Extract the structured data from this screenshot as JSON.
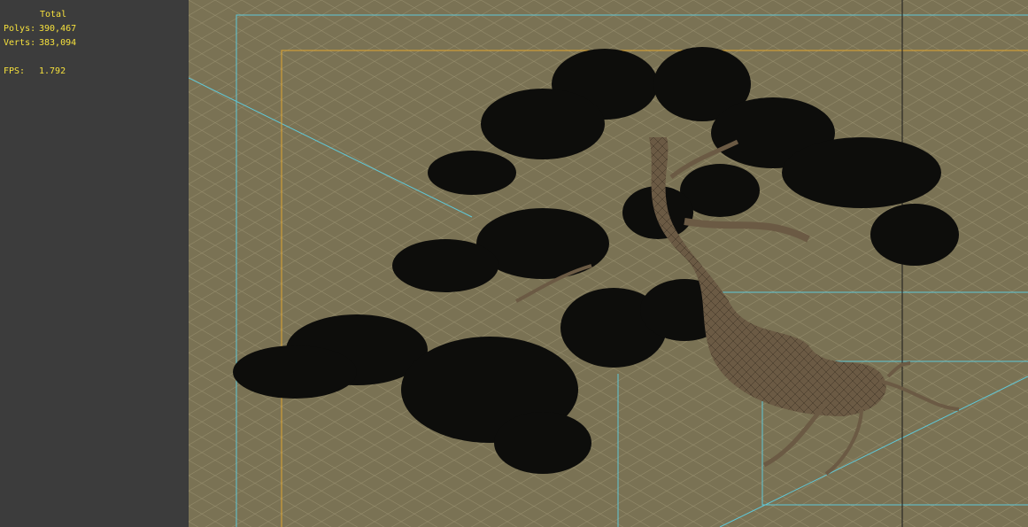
{
  "stats": {
    "header": "Total",
    "polys_label": "Polys:",
    "polys_value": "390,467",
    "verts_label": "Verts:",
    "verts_value": "383,094",
    "fps_label": "FPS:",
    "fps_value": "1.792"
  },
  "colors": {
    "panel": "#3c3c3c",
    "viewport_bg": "#7a7254",
    "stats_text": "#f5e03c",
    "safe_frame_cyan": "#5fc8d8",
    "safe_frame_orange": "#e0a630",
    "tree_foliage": "#0d0d0b",
    "trunk": "#6b5a44"
  },
  "icons": {
    "model": "bonsai-tree-wireframe"
  }
}
